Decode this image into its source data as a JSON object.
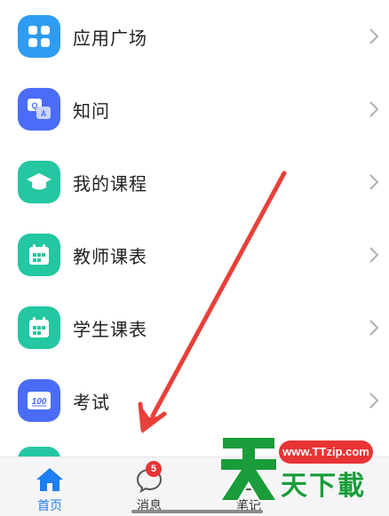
{
  "menu": {
    "items": [
      {
        "label": "应用广场",
        "icon": "grid-apps-icon",
        "color": "#2e9cf2"
      },
      {
        "label": "知问",
        "icon": "qa-chat-icon",
        "color": "#4a6cf7"
      },
      {
        "label": "我的课程",
        "icon": "graduation-cap-icon",
        "color": "#23c7a1"
      },
      {
        "label": "教师课表",
        "icon": "calendar-icon",
        "color": "#23c7a1"
      },
      {
        "label": "学生课表",
        "icon": "calendar-icon",
        "color": "#23c7a1"
      },
      {
        "label": "考试",
        "icon": "exam-score-icon",
        "color": "#4a6cf7"
      }
    ]
  },
  "tabbar": {
    "tabs": [
      {
        "label": "首页",
        "icon": "home-icon",
        "active": true
      },
      {
        "label": "消息",
        "icon": "chat-bubble-icon",
        "badge": "5"
      },
      {
        "label": "笔记",
        "icon": "note-icon"
      }
    ]
  },
  "exam_icon_text": "100",
  "watermark": {
    "url": "www.TTzip.com",
    "text": "天下載"
  },
  "colors": {
    "accent": "#1e7ef3",
    "arrow": "#e8403a",
    "badge": "#e83434",
    "watermark_green": "#1a9c3a"
  }
}
